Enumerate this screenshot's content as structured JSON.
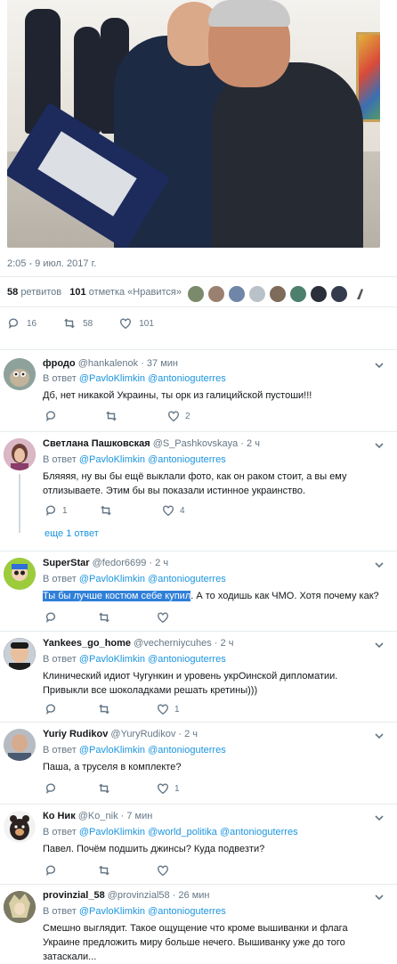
{
  "tweet": {
    "timestamp": "2:05 - 9 июл. 2017 г.",
    "retweets_count": "58",
    "retweets_label": "ретвитов",
    "likes_count": "101",
    "likes_label": "отметка «Нравится»",
    "actions": {
      "replies": "16",
      "retweets": "58",
      "likes": "101"
    }
  },
  "replies": [
    {
      "name": "фродо",
      "handle": "@hankalenok",
      "time": "· 37 мин",
      "reply_prefix": "В ответ",
      "to": [
        "@PavloKlimkin",
        "@antonioguterres"
      ],
      "text": "Дб, нет никакой Украины, ты орк из галицийской пустоши!!!",
      "counts": {
        "replies": "",
        "retweets": "",
        "likes": "2"
      }
    },
    {
      "name": "Светлана Пашковская",
      "handle": "@S_Pashkovskaya",
      "time": "· 2 ч",
      "reply_prefix": "В ответ",
      "to": [
        "@PavloKlimkin",
        "@antonioguterres"
      ],
      "text": "Бляяяя, ну вы бы ещё выклали фото, как он раком стоит, а вы ему отлизываете. Этим бы вы показали истинное украинство.",
      "counts": {
        "replies": "1",
        "retweets": "",
        "likes": "4"
      },
      "more_replies": "еще 1 ответ"
    },
    {
      "name": "SuperStar",
      "handle": "@fedor6699",
      "time": "· 2 ч",
      "reply_prefix": "В ответ",
      "to": [
        "@PavloKlimkin",
        "@antonioguterres"
      ],
      "text_highlight": "Ты бы лучше костюм себе купил",
      "text": ". А то ходишь как ЧМО. Хотя почему как?",
      "counts": {
        "replies": "",
        "retweets": "",
        "likes": ""
      }
    },
    {
      "name": "Yankees_go_home",
      "handle": "@vecherniycuhes",
      "time": "· 2 ч",
      "reply_prefix": "В ответ",
      "to": [
        "@PavloKlimkin",
        "@antonioguterres"
      ],
      "text": "Клинический идиот Чугункин и уровень укрОинской дипломатии. Привыкли все шоколадками решать кретины)))",
      "counts": {
        "replies": "",
        "retweets": "",
        "likes": "1"
      }
    },
    {
      "name": "Yuriy Rudikov",
      "handle": "@YuryRudikov",
      "time": "· 2 ч",
      "reply_prefix": "В ответ",
      "to": [
        "@PavloKlimkin",
        "@antonioguterres"
      ],
      "text": "Паша, а труселя в комплекте?",
      "counts": {
        "replies": "",
        "retweets": "",
        "likes": "1"
      }
    },
    {
      "name": "Ко Ник",
      "handle": "@Ko_nik",
      "time": "· 7 мин",
      "reply_prefix": "В ответ",
      "to": [
        "@PavloKlimkin",
        "@world_politika",
        "@antonioguterres"
      ],
      "text": "Павел. Почём подшить джинсы? Куда подвезти?",
      "counts": {
        "replies": "",
        "retweets": "",
        "likes": ""
      }
    },
    {
      "name": "provinzial_58",
      "handle": "@provinzial58",
      "time": "· 26 мин",
      "reply_prefix": "В ответ",
      "to": [
        "@PavloKlimkin",
        "@antonioguterres"
      ],
      "text": "Смешно выглядит. Такое ощущение что кроме вышиванки и флага Украине предложить миру больше нечего. Вышиванку уже до того затаскали...",
      "counts": {
        "replies": "",
        "retweets": "",
        "likes": ""
      }
    }
  ],
  "colors": {
    "link": "#1b95e0",
    "muted": "#657786",
    "highlight": "#2f7fd8"
  }
}
